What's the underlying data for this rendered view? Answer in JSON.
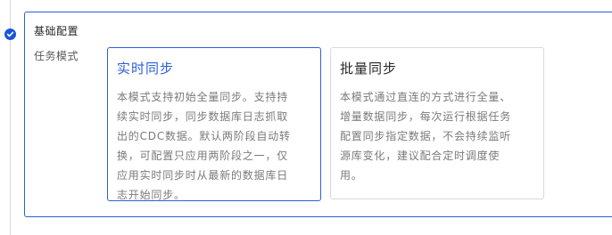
{
  "panel": {
    "title": "基础配置",
    "field_label": "任务模式"
  },
  "options": [
    {
      "title": "实时同步",
      "selected": true,
      "description_lines": [
        "本模式支持初始全量同步。支持持",
        "续实时同步，同步数据库日志抓取",
        "出的CDC数据。默认两阶段自动转",
        "换，可配置只应用两阶段之一，仅",
        "应用实时同步时从最新的数据库日",
        "志开始同步。"
      ]
    },
    {
      "title": "批量同步",
      "selected": false,
      "description_lines": [
        "本模式通过直连的方式进行全量、",
        "增量数据同步，每次运行根据任务",
        "配置同步指定数据，不会持续监听",
        "源库变化，建议配合定时调度使",
        "用。"
      ]
    }
  ],
  "colors": {
    "accent": "#2b5fd9",
    "step_check": "#1a56db",
    "border_default": "#d9d9d9",
    "text_primary": "#262626",
    "text_secondary": "#7a7a7a"
  },
  "icons": {
    "step_status": "check-circle-icon"
  }
}
